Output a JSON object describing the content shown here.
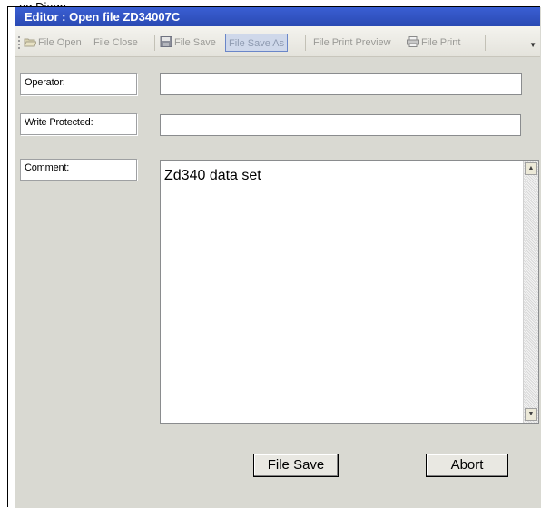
{
  "window": {
    "clipped_caption": "og Diagn",
    "title": "Editor : Open file ZD34007C"
  },
  "toolbar": {
    "file_open": "File Open",
    "file_close": "File Close",
    "file_save": "File Save",
    "file_save_as": "File Save As",
    "file_print_preview": "File Print Preview",
    "file_print": "File Print"
  },
  "form": {
    "operator_label": "Operator:",
    "operator_value": "",
    "write_protected_label": "Write Protected:",
    "write_protected_value": "",
    "comment_label": "Comment:",
    "comment_value": "Zd340 data set"
  },
  "buttons": {
    "save": "File Save",
    "abort": "Abort"
  },
  "colors": {
    "title_bar": "#2a4ab3",
    "window_bg": "#d9d9d2",
    "toolbar_active_border": "#6a86c8"
  }
}
